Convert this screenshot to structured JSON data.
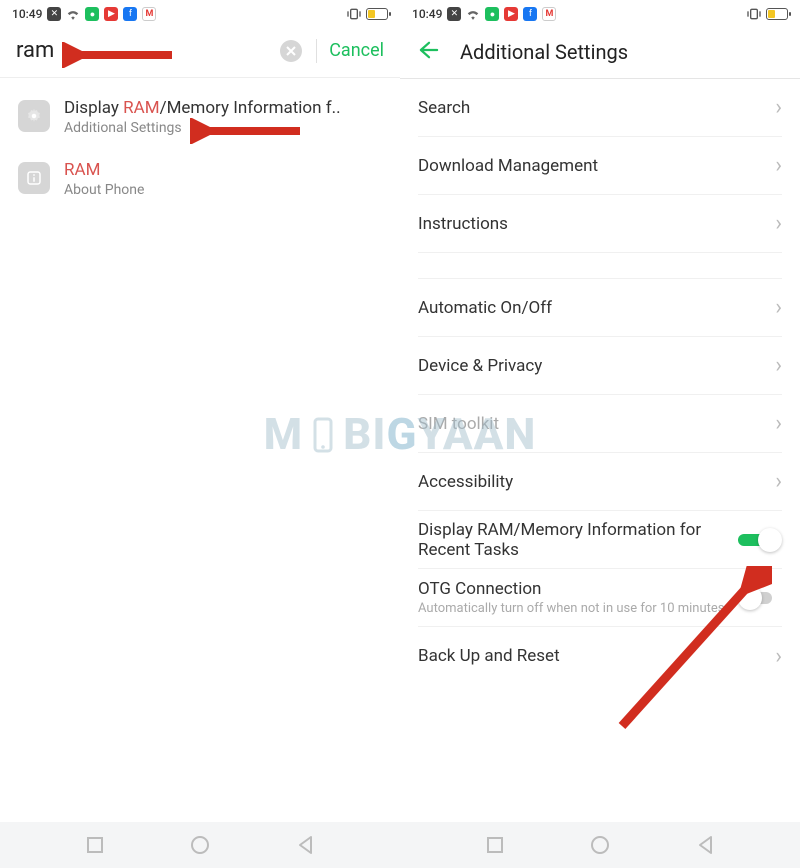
{
  "status": {
    "time": "10:49"
  },
  "left": {
    "search_value": "ram",
    "cancel_label": "Cancel",
    "results": [
      {
        "title_prefix": "Display ",
        "title_hl": "RAM",
        "title_suffix": "/Memory Information f..",
        "subtitle": "Additional Settings",
        "icon": "settings-gear-icon"
      },
      {
        "title_prefix": "",
        "title_hl": "RAM",
        "title_suffix": "",
        "subtitle": "About Phone",
        "icon": "info-icon"
      }
    ]
  },
  "right": {
    "title": "Additional Settings",
    "group1": [
      {
        "label": "Search"
      },
      {
        "label": "Download Management"
      },
      {
        "label": "Instructions"
      }
    ],
    "group2": [
      {
        "label": "Automatic On/Off"
      },
      {
        "label": "Device & Privacy"
      },
      {
        "label": "SIM toolkit",
        "dim": true
      },
      {
        "label": "Accessibility"
      }
    ],
    "toggle1": {
      "label": "Display RAM/Memory Information for Recent Tasks",
      "on": true
    },
    "toggle2": {
      "label": "OTG Connection",
      "sub": "Automatically turn off when not in use for 10 minutes.",
      "on": false
    },
    "group3": [
      {
        "label": "Back Up and Reset"
      }
    ]
  },
  "watermark_text": "MOBIGYAAN"
}
